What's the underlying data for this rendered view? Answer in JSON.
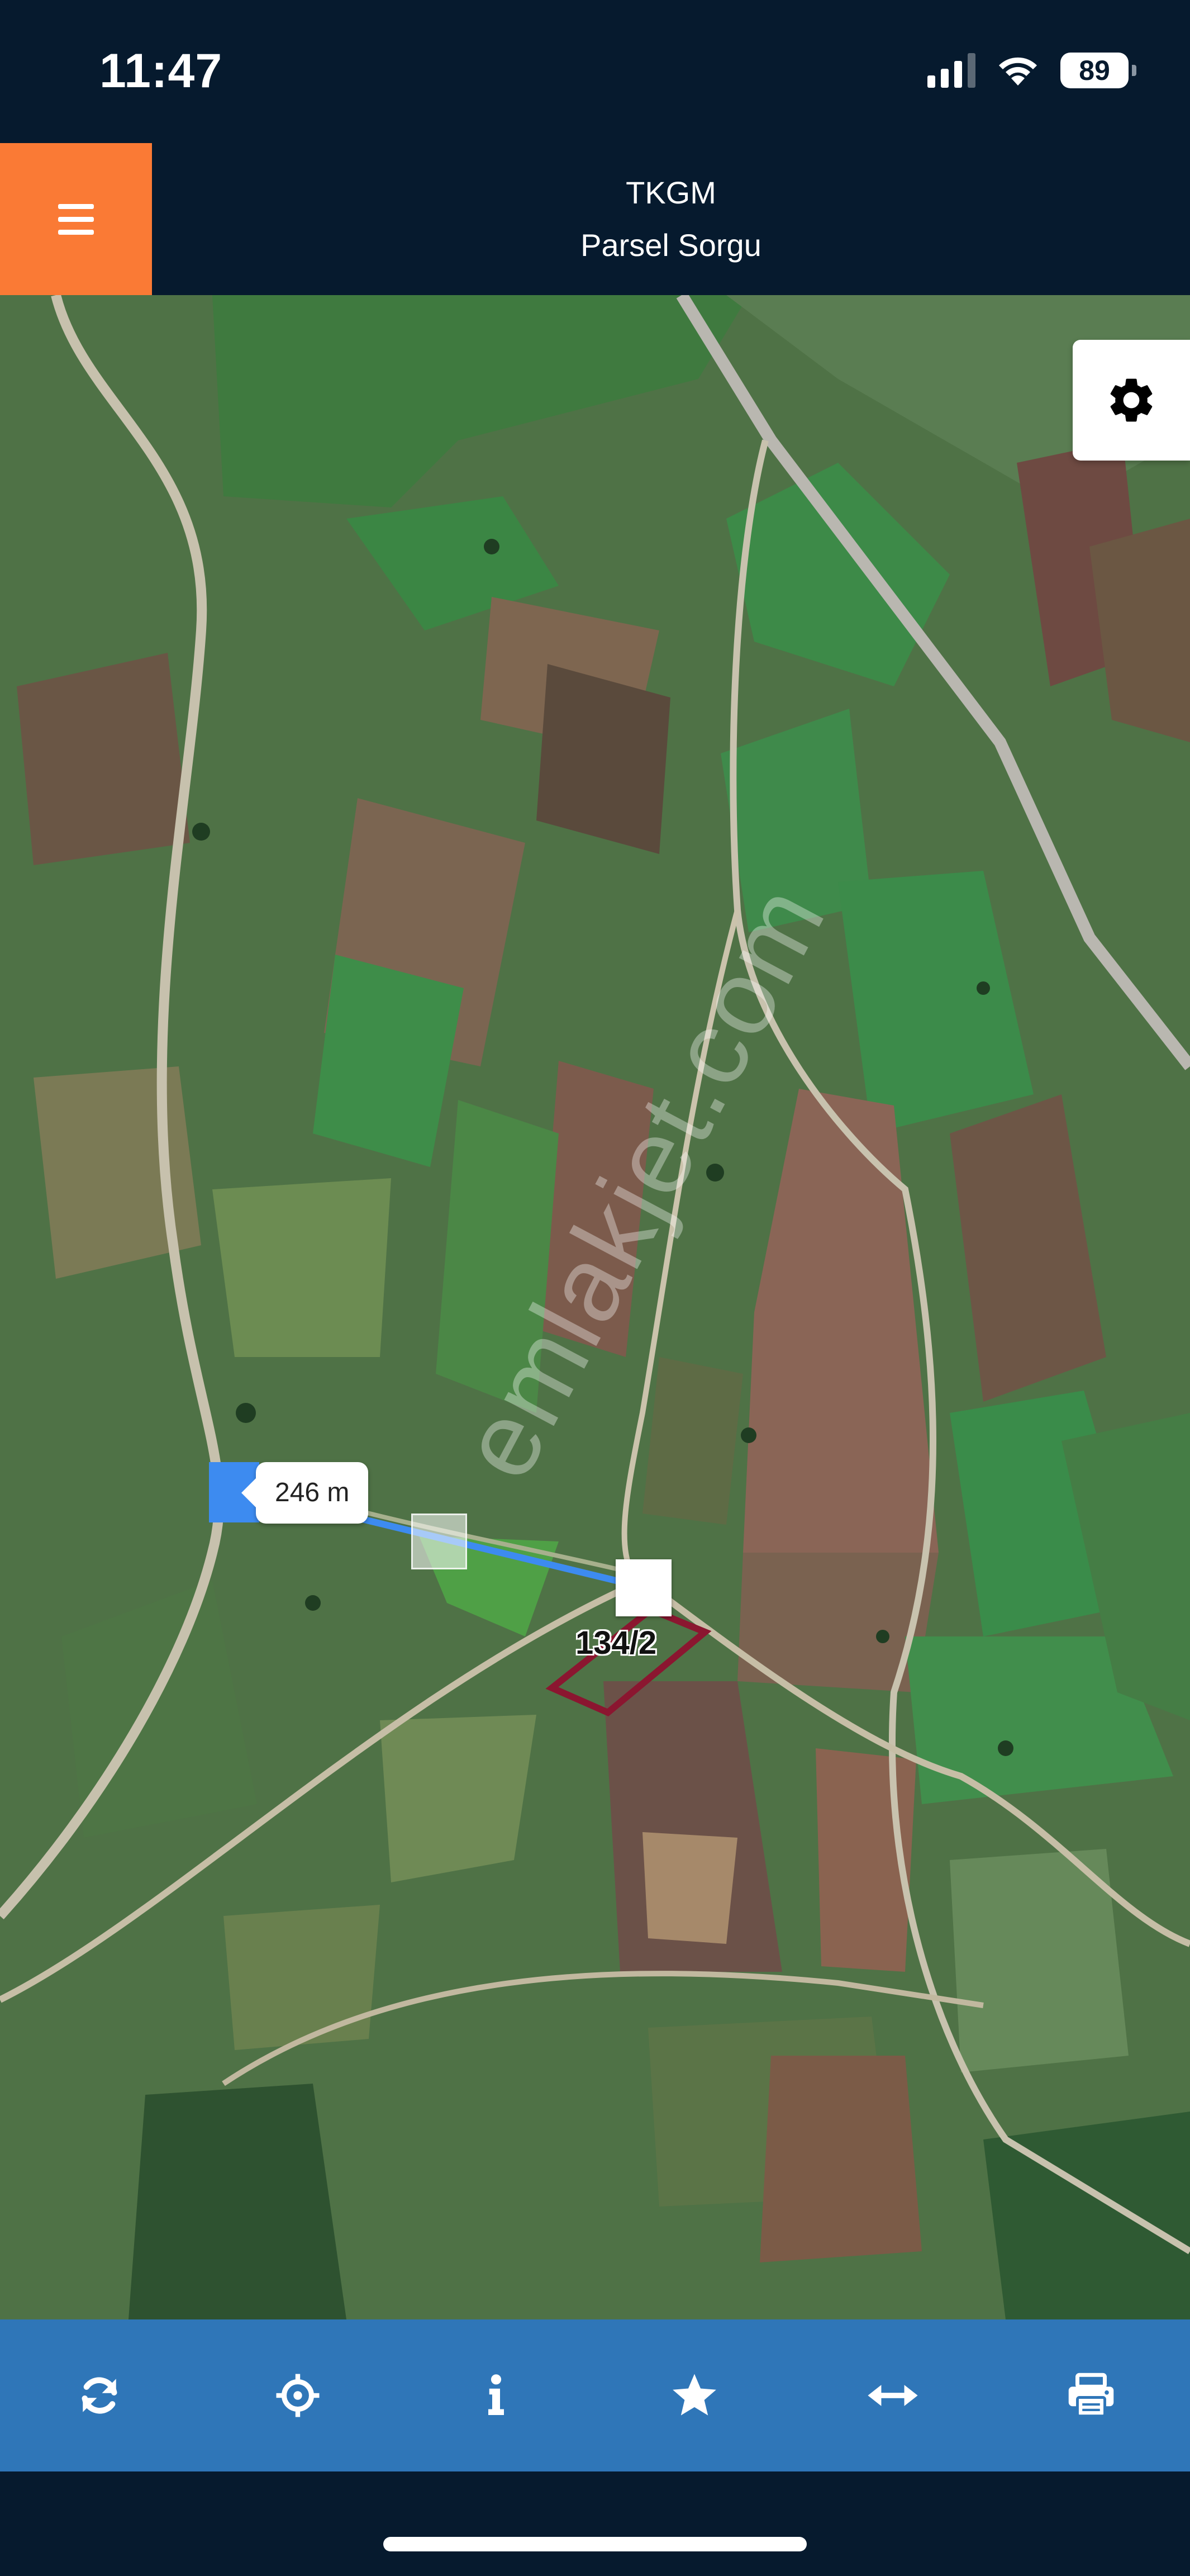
{
  "status_bar": {
    "time": "11:47",
    "battery": "89",
    "icons": [
      "cellular-signal-icon",
      "wifi-icon",
      "battery-icon"
    ]
  },
  "header": {
    "title": "TKGM",
    "subtitle": "Parsel Sorgu",
    "menu_icon": "hamburger-menu-icon",
    "menu_color": "#fa7a35",
    "background": "#061a2e"
  },
  "map": {
    "settings_icon": "gear-icon",
    "watermark": "emlakjet.com",
    "measurement": {
      "distance_label": "246 m",
      "line_color": "#3d8bf0"
    },
    "parcel": {
      "label": "134/2",
      "outline_color": "#8b1630"
    }
  },
  "toolbar": {
    "background": "#2f76b8",
    "buttons": [
      {
        "icon": "refresh-icon"
      },
      {
        "icon": "locate-crosshair-icon"
      },
      {
        "icon": "info-icon"
      },
      {
        "icon": "star-icon"
      },
      {
        "icon": "measure-arrows-icon"
      },
      {
        "icon": "print-icon"
      }
    ]
  }
}
